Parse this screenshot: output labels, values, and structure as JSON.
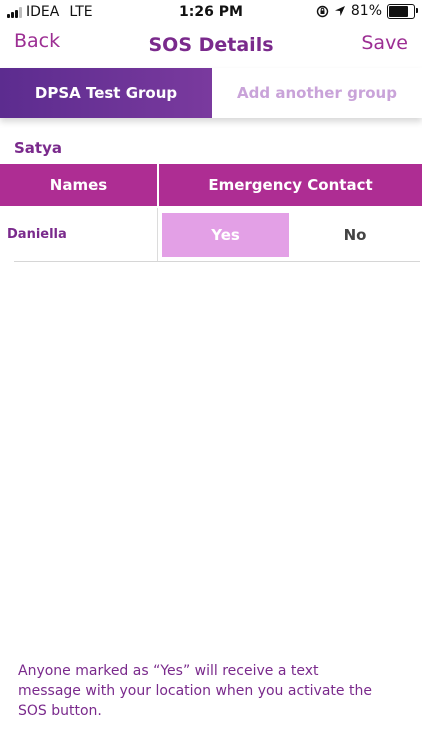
{
  "status_bar": {
    "carrier": "IDEA",
    "network": "LTE",
    "time": "1:26 PM",
    "battery": "81%",
    "battery_level": 0.81
  },
  "nav": {
    "back_label": "Back",
    "title": "SOS Details",
    "save_label": "Save"
  },
  "tabs": [
    {
      "label": "DPSA Test Group",
      "active": true
    },
    {
      "label": "Add another group",
      "active": false
    }
  ],
  "group": {
    "member_name": "Satya"
  },
  "table": {
    "headers": [
      "Names",
      "Emergency Contact"
    ],
    "rows": [
      {
        "name": "Daniella",
        "yes_label": "Yes",
        "no_label": "No",
        "selected": "Yes"
      }
    ]
  },
  "footer_note": "Anyone marked as “Yes” will receive a text message with your location when you activate the SOS button.",
  "colors": {
    "primary_purple": "#7a2a8c",
    "header_magenta": "#ae2d93",
    "selected_pink": "#e3a0e6"
  }
}
